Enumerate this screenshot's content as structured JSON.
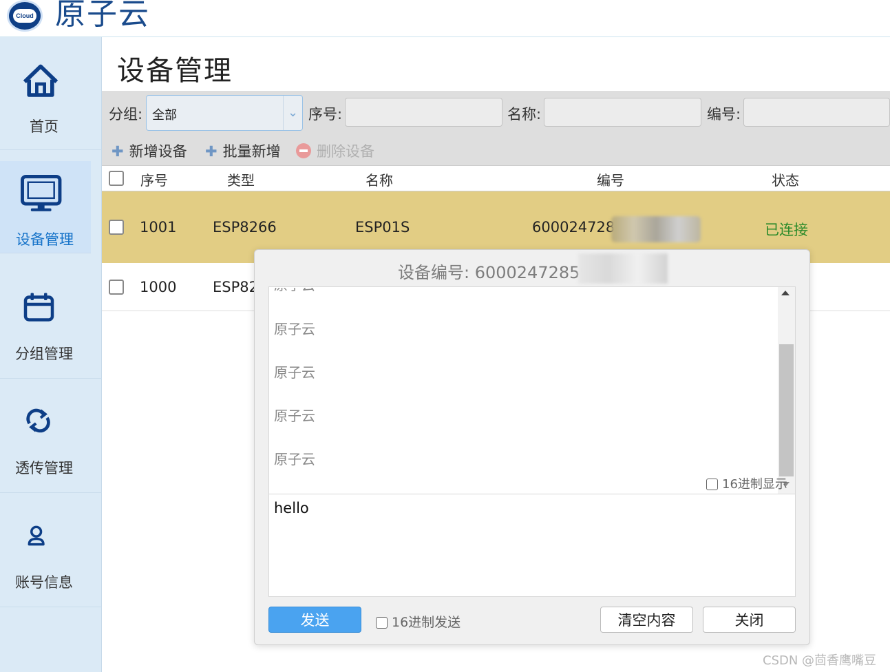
{
  "header": {
    "logo_badge": "Cloud",
    "logo_text": "原子云"
  },
  "sidebar": {
    "items": [
      {
        "label": "首页",
        "icon": "home-icon",
        "active": false
      },
      {
        "label": "设备管理",
        "icon": "monitor-icon",
        "active": true
      },
      {
        "label": "分组管理",
        "icon": "calendar-icon",
        "active": false
      },
      {
        "label": "透传管理",
        "icon": "sync-icon",
        "active": false
      },
      {
        "label": "账号信息",
        "icon": "user-icon",
        "active": false
      }
    ]
  },
  "page": {
    "title": "设备管理"
  },
  "filters": {
    "group_label": "分组:",
    "group_value": "全部",
    "seq_label": "序号:",
    "seq_value": "",
    "name_label": "名称:",
    "name_value": "",
    "code_label": "编号:",
    "code_value": ""
  },
  "toolbar": {
    "add_label": "新增设备",
    "batch_add_label": "批量新增",
    "delete_label": "删除设备"
  },
  "table": {
    "columns": [
      "序号",
      "类型",
      "名称",
      "编号",
      "状态"
    ],
    "rows": [
      {
        "seq": "1001",
        "type": "ESP8266",
        "name": "ESP01S",
        "code": "60002472859",
        "status": "已连接",
        "selected": true
      },
      {
        "seq": "1000",
        "type": "ESP82",
        "name": "",
        "code": "",
        "status": "",
        "selected": false
      }
    ]
  },
  "dialog": {
    "title": "设备编号: 60002472859",
    "received_messages": [
      "原子云",
      "原子云",
      "原子云",
      "原子云"
    ],
    "hex_display_label": "16进制显示",
    "send_text": "hello",
    "send_button": "发送",
    "hex_send_label": "16进制发送",
    "clear_button": "清空内容",
    "close_button": "关闭"
  },
  "watermark": "CSDN @茴香鹰嘴豆",
  "colors": {
    "accent": "#1673c9",
    "selected_row": "#e2cd84",
    "status_ok": "#2a8a2a",
    "send_button": "#4aa3f0",
    "sidebar_bg": "#dbeaf6",
    "logo": "#1a4b8c"
  }
}
